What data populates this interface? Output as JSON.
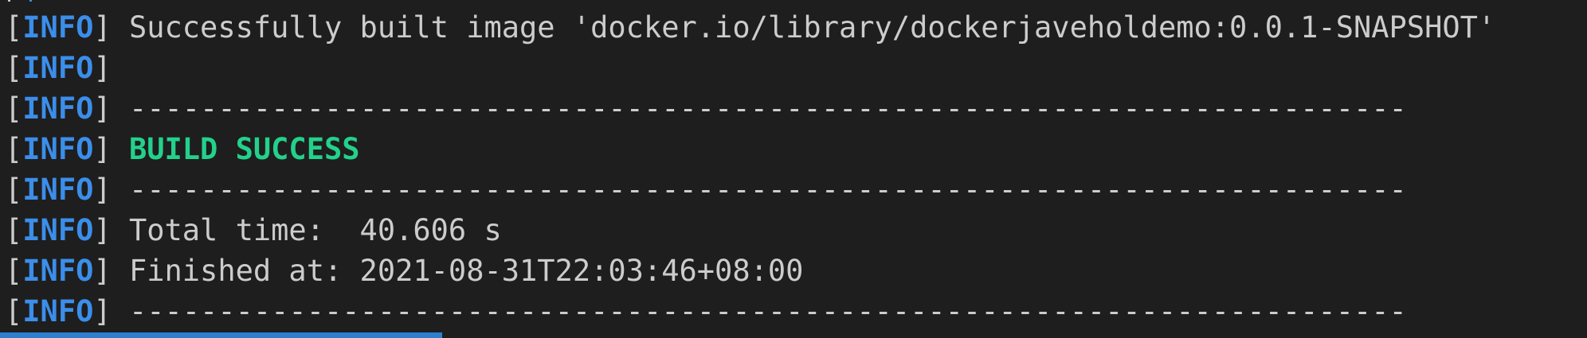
{
  "terminal": {
    "level_label": "INFO",
    "lines": [
      {
        "text": "Successfully built image 'docker.io/library/dockerjaveholdemo:0.0.1-SNAPSHOT'",
        "style": "plain"
      },
      {
        "text": "",
        "style": "plain"
      },
      {
        "text": "------------------------------------------------------------------------",
        "style": "plain"
      },
      {
        "text": "BUILD SUCCESS",
        "style": "success"
      },
      {
        "text": "------------------------------------------------------------------------",
        "style": "plain"
      },
      {
        "text": "Total time:  40.606 s",
        "style": "plain"
      },
      {
        "text": "Finished at: 2021-08-31T22:03:46+08:00",
        "style": "plain"
      },
      {
        "text": "------------------------------------------------------------------------",
        "style": "plain"
      }
    ],
    "colors": {
      "background": "#1e1e1e",
      "text": "#cccccc",
      "info": "#3b8eea",
      "success": "#23d18b",
      "scrollbar": "#2f7fcf"
    }
  }
}
